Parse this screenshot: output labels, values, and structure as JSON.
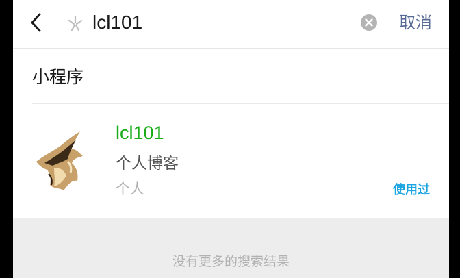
{
  "search": {
    "query": "lcl101",
    "cancel_label": "取消"
  },
  "section": {
    "title": "小程序"
  },
  "result": {
    "name": "lcl101",
    "description": "个人博客",
    "category": "个人",
    "used_badge": "使用过"
  },
  "footer": {
    "no_more_text": "没有更多的搜索结果"
  },
  "icons": {
    "back": "chevron-left-icon",
    "mini_program": "mini-program-icon",
    "clear": "clear-circle-icon"
  },
  "colors": {
    "accent_green": "#1aad19",
    "link_blue": "#576b95",
    "badge_blue": "#1aa4e0",
    "background": "#ededed"
  }
}
